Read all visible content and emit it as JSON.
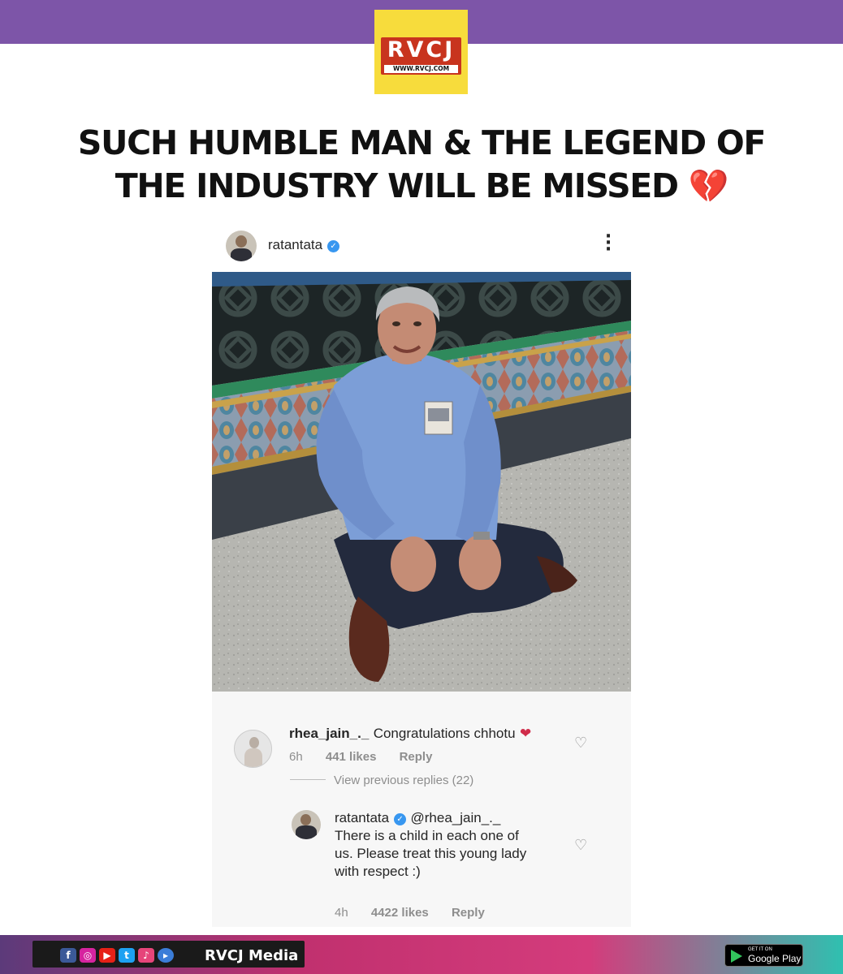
{
  "brand": {
    "logo_text": "RVCJ",
    "logo_url": "WWW.RVCJ.COM",
    "colors": {
      "top_bar": "#7d55a8",
      "logo_bg": "#f7dc3c",
      "logo_plate": "#c8341e"
    }
  },
  "headline": {
    "line1": "SUCH HUMBLE MAN & THE LEGEND OF",
    "line2": "THE INDUSTRY WILL BE MISSED",
    "emoji": "💔"
  },
  "post": {
    "username": "ratantata",
    "verified": true,
    "more_icon": "more-vertical-icon",
    "photo_icon": "photo"
  },
  "comments": {
    "first": {
      "user": "rhea_jain_._",
      "text": "Congratulations chhotu",
      "emoji": "❤",
      "time": "6h",
      "likes": "441 likes",
      "reply": "Reply"
    },
    "view_replies": "View previous replies (22)",
    "second": {
      "user": "ratantata",
      "mention": "@rhea_jain_._",
      "text_line1": "There is a child in each one of",
      "text_line2": "us. Please treat this young lady",
      "text_line3": "with respect :)",
      "time": "4h",
      "likes": "4422 likes",
      "reply": "Reply"
    }
  },
  "footer": {
    "brand_name": "RVCJ Media",
    "store_small": "GET IT ON",
    "store_big": "Google Play",
    "social_icons": [
      "facebook-icon",
      "instagram-icon",
      "youtube-icon",
      "twitter-icon",
      "tiktok-icon",
      "play-icon"
    ]
  }
}
